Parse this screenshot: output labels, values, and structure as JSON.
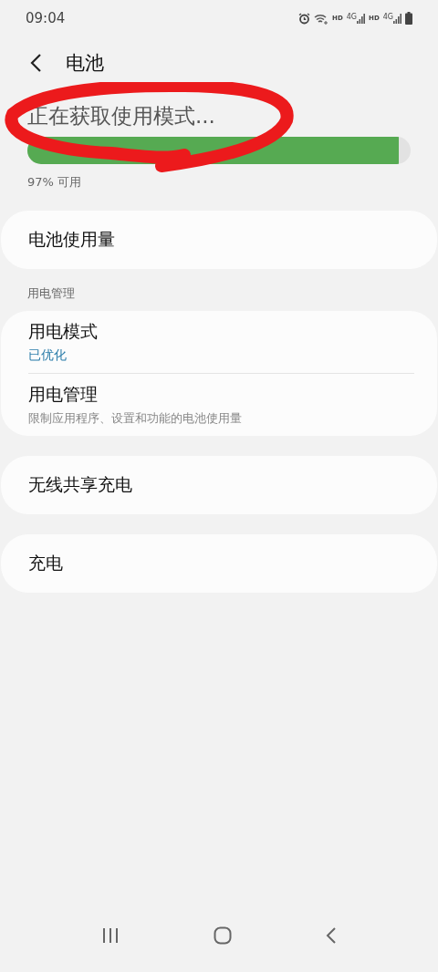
{
  "status_bar": {
    "time": "09:04",
    "hd_labels": [
      "HD",
      "HD"
    ],
    "network_labels": [
      "4G",
      "4G"
    ]
  },
  "header": {
    "title": "电池"
  },
  "battery": {
    "status": "正在获取使用模式...",
    "level": 0.97,
    "available": "97% 可用"
  },
  "sections": [
    {
      "items": [
        {
          "title": "电池使用量"
        }
      ]
    },
    {
      "label": "用电管理",
      "items": [
        {
          "title": "用电模式",
          "value": "已优化"
        },
        {
          "title": "用电管理",
          "description": "限制应用程序、设置和功能的电池使用量"
        }
      ]
    },
    {
      "items": [
        {
          "title": "无线共享充电"
        }
      ]
    },
    {
      "items": [
        {
          "title": "充电"
        }
      ]
    }
  ]
}
